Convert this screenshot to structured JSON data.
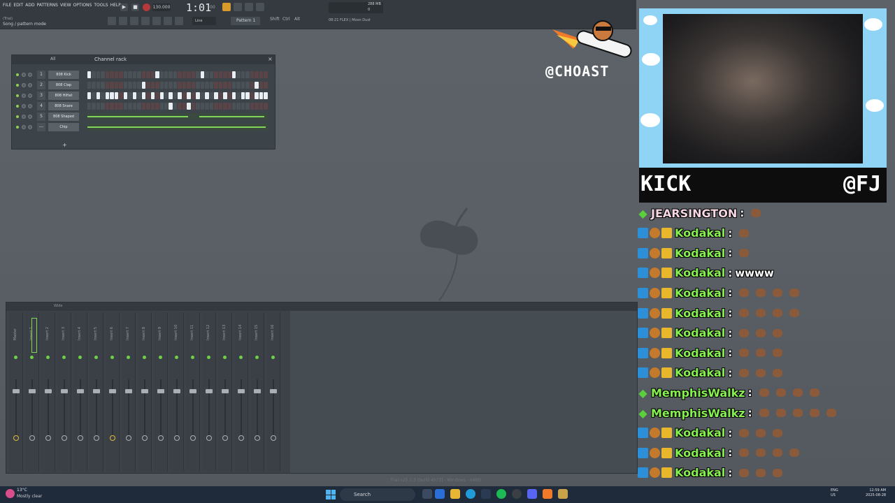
{
  "menu": [
    "FILE",
    "EDIT",
    "ADD",
    "PATTERNS",
    "VIEW",
    "OPTIONS",
    "TOOLS",
    "HELP"
  ],
  "toolbar": {
    "title_small": "(Trial)",
    "mode": "Song / pattern mode",
    "tempo": "130.000",
    "time": "1:01",
    "time_unit": "00",
    "pattern": "Pattern 1",
    "snap": "Line",
    "shift": "Shift",
    "ctrl": "Ctrl",
    "alt": "Alt",
    "preset": "08:21  FLEX | Moon Dust",
    "memory": "288 MB",
    "cpu": "0"
  },
  "channel_rack": {
    "title": "Channel rack",
    "filter": "All",
    "add": "+",
    "channels": [
      {
        "num": "1",
        "name": "808 Kick",
        "steps": [
          1,
          0,
          0,
          0,
          0,
          0,
          0,
          0,
          0,
          0,
          0,
          0,
          0,
          0,
          0,
          1,
          0,
          0,
          0,
          0,
          0,
          0,
          0,
          0,
          0,
          1,
          0,
          0,
          0,
          0,
          0,
          0,
          1,
          0,
          0,
          0,
          0,
          0,
          0,
          0
        ]
      },
      {
        "num": "2",
        "name": "808 Clap",
        "steps": [
          0,
          0,
          0,
          0,
          0,
          0,
          0,
          0,
          0,
          0,
          0,
          0,
          1,
          0,
          0,
          0,
          0,
          0,
          0,
          0,
          0,
          0,
          0,
          0,
          0,
          0,
          0,
          0,
          0,
          0,
          0,
          0,
          0,
          0,
          0,
          0,
          0,
          1,
          0,
          0
        ]
      },
      {
        "num": "3",
        "name": "808 HiHat",
        "steps": [
          1,
          0,
          1,
          0,
          1,
          1,
          1,
          0,
          1,
          0,
          1,
          0,
          1,
          0,
          1,
          0,
          1,
          0,
          1,
          0,
          1,
          0,
          1,
          0,
          1,
          0,
          1,
          0,
          1,
          0,
          1,
          0,
          1,
          0,
          1,
          1,
          0,
          1,
          1,
          1
        ]
      },
      {
        "num": "4",
        "name": "808 Snare",
        "steps": [
          0,
          0,
          0,
          0,
          0,
          0,
          0,
          0,
          0,
          0,
          0,
          0,
          0,
          0,
          0,
          0,
          0,
          0,
          1,
          0,
          0,
          0,
          1,
          0,
          0,
          0,
          0,
          0,
          0,
          0,
          0,
          0,
          0,
          0,
          0,
          0,
          0,
          0,
          0,
          0
        ]
      },
      {
        "num": "5",
        "name": "808 Shaped",
        "steps": []
      },
      {
        "num": "---",
        "name": "Chip",
        "steps": []
      }
    ]
  },
  "mixer": {
    "title": "Wide",
    "tracks": [
      "Master",
      "Insert 1",
      "Insert 2",
      "Insert 3",
      "Insert 4",
      "Insert 5",
      "Insert 6",
      "Insert 7",
      "Insert 8",
      "Insert 9",
      "Insert 10",
      "Insert 11",
      "Insert 12",
      "Insert 13",
      "Insert 14",
      "Insert 15",
      "Insert 16"
    ]
  },
  "overlay": {
    "sponsor_handle": "@CHOAST",
    "platform": "KICK",
    "handle": "@FJ"
  },
  "chat": [
    {
      "user": "JEARSINGTON",
      "color": "pink",
      "badges": [
        "green"
      ],
      "message": "",
      "emotes": 1
    },
    {
      "user": "Kodakal",
      "color": "green",
      "badges": [
        "blue",
        "orange",
        "crown"
      ],
      "message": "",
      "emotes": 1
    },
    {
      "user": "Kodakal",
      "color": "green",
      "badges": [
        "blue",
        "orange",
        "crown"
      ],
      "message": "",
      "emotes": 1
    },
    {
      "user": "Kodakal",
      "color": "green",
      "badges": [
        "blue",
        "orange",
        "crown"
      ],
      "message": "wwww",
      "emotes": 0
    },
    {
      "user": "Kodakal",
      "color": "green",
      "badges": [
        "blue",
        "orange",
        "crown"
      ],
      "message": "",
      "emotes": 4
    },
    {
      "user": "Kodakal",
      "color": "green",
      "badges": [
        "blue",
        "orange",
        "crown"
      ],
      "message": "",
      "emotes": 4
    },
    {
      "user": "Kodakal",
      "color": "green",
      "badges": [
        "blue",
        "orange",
        "crown"
      ],
      "message": "",
      "emotes": 3
    },
    {
      "user": "Kodakal",
      "color": "green",
      "badges": [
        "blue",
        "orange",
        "crown"
      ],
      "message": "",
      "emotes": 3
    },
    {
      "user": "Kodakal",
      "color": "green",
      "badges": [
        "blue",
        "orange",
        "crown"
      ],
      "message": "",
      "emotes": 3
    },
    {
      "user": "MemphisWalkz",
      "color": "green",
      "badges": [
        "green"
      ],
      "message": "",
      "emotes": 4
    },
    {
      "user": "MemphisWalkz",
      "color": "green",
      "badges": [
        "green"
      ],
      "message": "",
      "emotes": 5
    },
    {
      "user": "Kodakal",
      "color": "green",
      "badges": [
        "blue",
        "orange",
        "crown"
      ],
      "message": "",
      "emotes": 3
    },
    {
      "user": "Kodakal",
      "color": "green",
      "badges": [
        "blue",
        "orange",
        "crown"
      ],
      "message": "",
      "emotes": 4
    },
    {
      "user": "Kodakal",
      "color": "green",
      "badges": [
        "blue",
        "orange",
        "crown"
      ],
      "message": "",
      "emotes": 3
    }
  ],
  "chat_separator": ":",
  "taskbar": {
    "weather_temp": "13°C",
    "weather_desc": "Mostly clear",
    "search": "Search",
    "lang_1": "ENG",
    "lang_2": "US",
    "clock_time": "12:59 AM",
    "clock_date": "2025-08-28"
  },
  "trial_text": "Trial v25.1.3 [build 4973] - Windows - 64Bit",
  "colors": {
    "accent_green": "#86f04f",
    "kick_green": "#5ad13c",
    "cam_sky": "#8fd4f5",
    "record_red": "#b5383a"
  }
}
